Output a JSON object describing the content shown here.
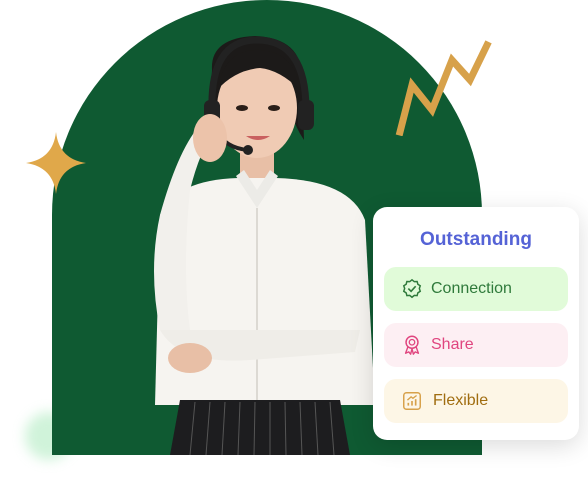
{
  "card": {
    "title": "Outstanding",
    "items": [
      {
        "label": "Connection",
        "icon": "badge-check-icon"
      },
      {
        "label": "Share",
        "icon": "award-ribbon-icon"
      },
      {
        "label": "Flexible",
        "icon": "growth-chart-icon"
      }
    ]
  },
  "colors": {
    "arch": "#0f5a32",
    "title": "#5563d6",
    "gold": "#d7a14a"
  }
}
